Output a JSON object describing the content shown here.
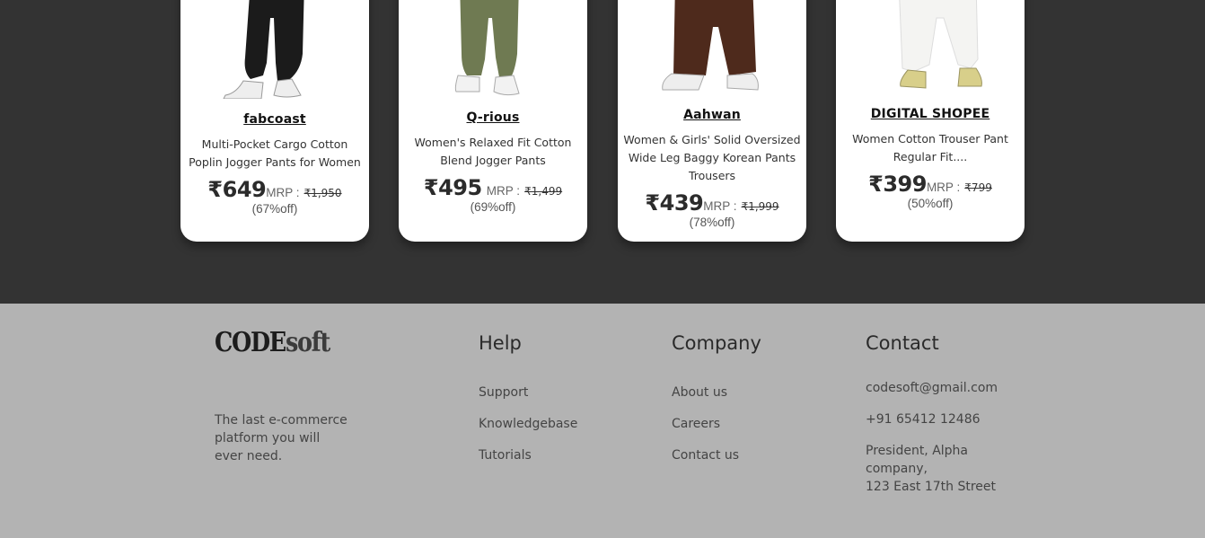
{
  "currency_symbol": "₹",
  "mrp_label": "MRP :",
  "products": [
    {
      "brand": "fabcoast",
      "description": "Multi-Pocket Cargo Cotton Poplin Jogger Pants for Women",
      "price": "₹649",
      "mrp": "₹1,950",
      "discount": "(67%off)",
      "pants_color": "#1b1b1b"
    },
    {
      "brand": "Q-rious",
      "description": "Women's Relaxed Fit Cotton Blend Jogger Pants",
      "price": "₹495",
      "mrp": "₹1,499",
      "discount": "(69%off)",
      "pants_color": "#6f7a52"
    },
    {
      "brand": "Aahwan",
      "description": "Women & Girls' Solid Oversized Wide Leg Baggy Korean Pants Trousers",
      "price": "₹439",
      "mrp": "₹1,999",
      "discount": "(78%off)",
      "pants_color": "#4e2a1c"
    },
    {
      "brand": "DIGITAL SHOPEE",
      "description": "Women Cotton Trouser Pant Regular Fit....",
      "price": "₹399",
      "mrp": "₹799",
      "discount": "(50%off)",
      "pants_color": "#f4f4f2"
    }
  ],
  "footer": {
    "logo_primary": "CODE",
    "logo_secondary": "soft",
    "tagline": "The last e-commerce platform you will ever need.",
    "help": {
      "title": "Help",
      "links": [
        "Support",
        "Knowledgebase",
        "Tutorials"
      ]
    },
    "company": {
      "title": "Company",
      "links": [
        "About us",
        "Careers",
        "Contact us"
      ]
    },
    "contact": {
      "title": "Contact",
      "email": "codesoft@gmail.com",
      "phone": "+91 65412 12486",
      "address_line1": "President, Alpha company,",
      "address_line2": "123 East 17th Street"
    }
  },
  "colors": {
    "section_bg": "#333333",
    "footer_bg": "#b3b3b3",
    "card_bg": "#ffffff"
  }
}
